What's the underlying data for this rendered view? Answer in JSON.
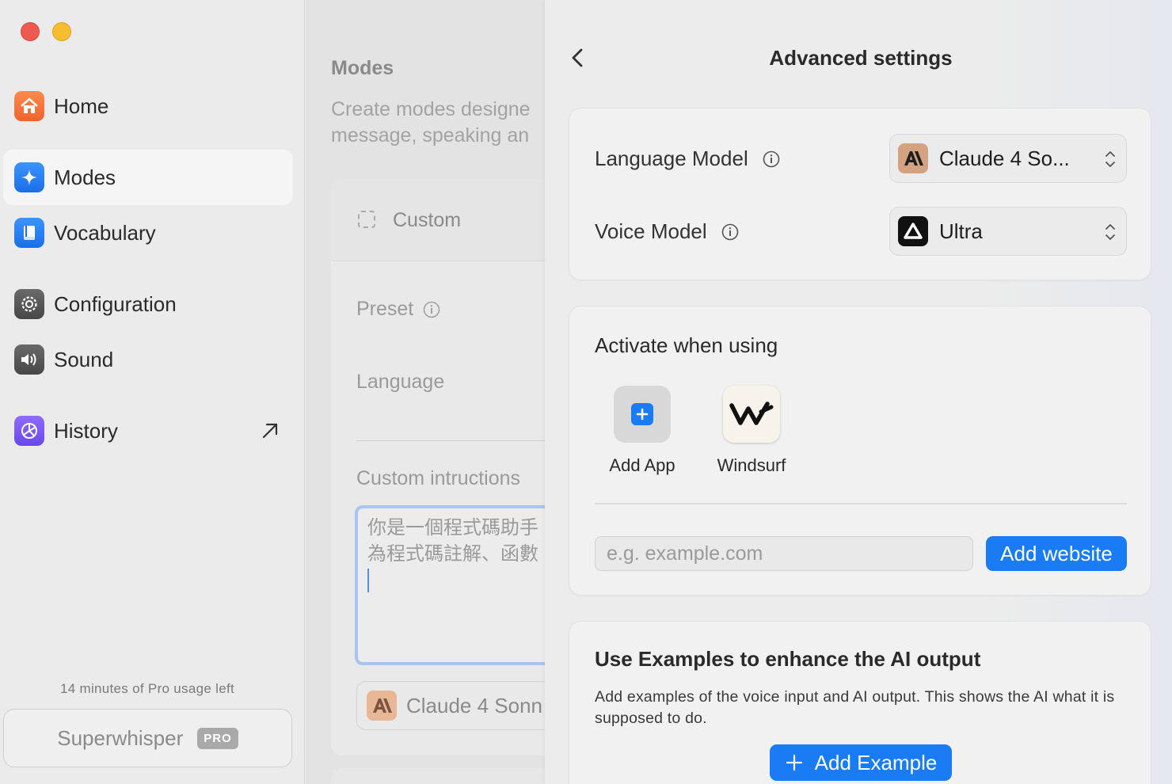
{
  "sidebar": {
    "items": [
      {
        "label": "Home",
        "icon": "home-icon",
        "color": "#f26b3a"
      },
      {
        "label": "Modes",
        "icon": "sparkle-icon",
        "color": "#1a7cf5"
      },
      {
        "label": "Vocabulary",
        "icon": "book-icon",
        "color": "#1a7cf5"
      },
      {
        "label": "Configuration",
        "icon": "gear-icon",
        "color": "#555555"
      },
      {
        "label": "Sound",
        "icon": "speaker-icon",
        "color": "#555555"
      },
      {
        "label": "History",
        "icon": "history-icon",
        "color": "#7c5cf5"
      }
    ],
    "usage_text": "14 minutes of Pro usage left",
    "brand_label": "Superwhisper",
    "pro_badge": "PRO"
  },
  "middle": {
    "title": "Modes",
    "description_line1": "Create modes designe",
    "description_line2": "message, speaking an",
    "mode_name": "Custom",
    "preset_label": "Preset",
    "language_label": "Language",
    "custom_instructions_label": "Custom intructions",
    "instructions_text": "你是一個程式碼助手\n為程式碼註解、函數",
    "model_label": "Claude 4 Sonn"
  },
  "panel": {
    "title": "Advanced settings",
    "language_model": {
      "label": "Language Model",
      "value": "Claude 4 So..."
    },
    "voice_model": {
      "label": "Voice Model",
      "value": "Ultra"
    },
    "activate": {
      "title": "Activate when using",
      "add_app_label": "Add App",
      "apps": [
        {
          "label": "Windsurf",
          "icon": "windsurf-icon"
        }
      ],
      "website_placeholder": "e.g. example.com",
      "add_website_label": "Add website"
    },
    "examples": {
      "title": "Use Examples to enhance the AI output",
      "description": "Add examples of the voice input and AI output. This shows the AI what it is supposed to do.",
      "add_label": "Add Example"
    }
  },
  "colors": {
    "accent": "#1a7cf5",
    "anthropic": "#d4a27f",
    "window_red": "#ee5a52",
    "window_yellow": "#f5bd2f"
  }
}
